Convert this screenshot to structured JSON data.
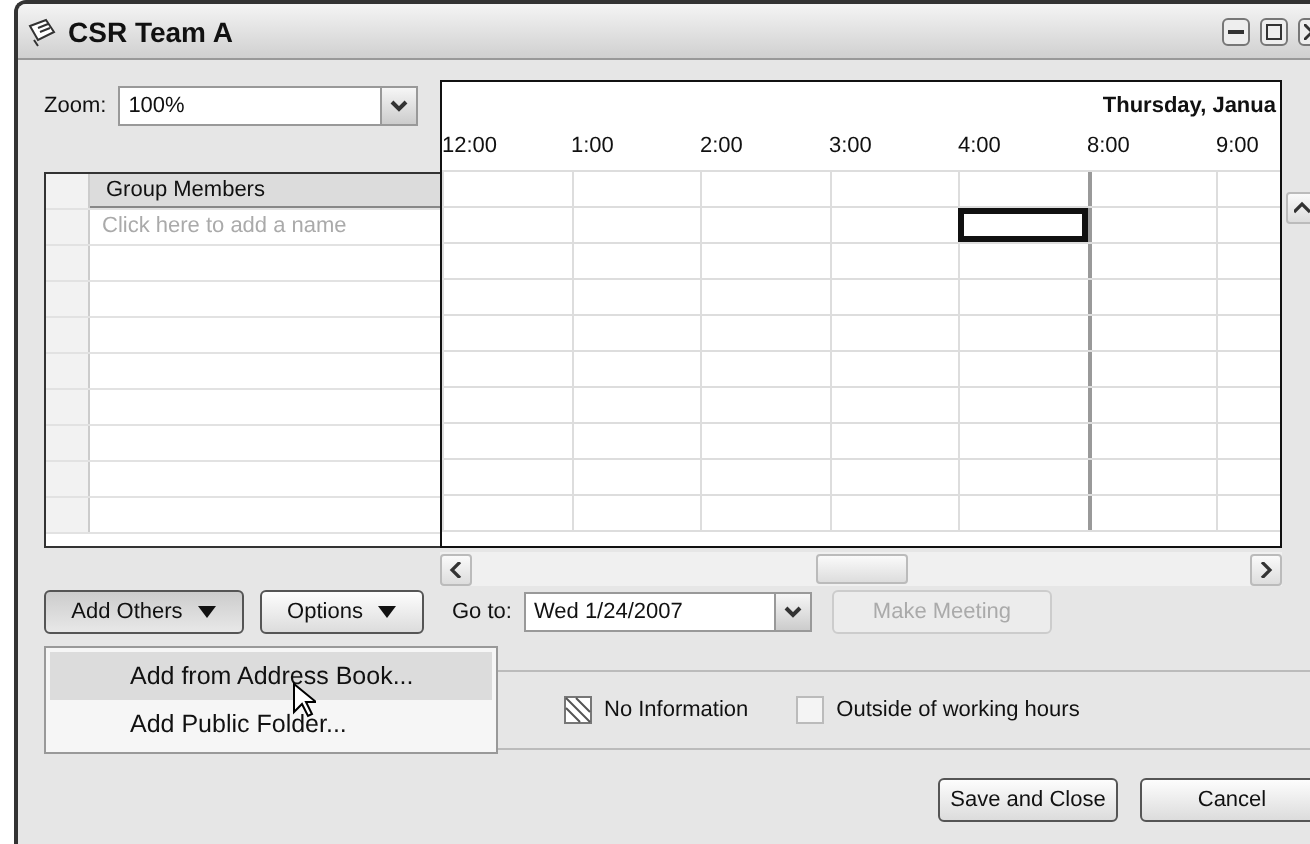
{
  "window": {
    "title": "CSR Team A"
  },
  "zoom": {
    "label": "Zoom:",
    "value": "100%"
  },
  "group_members": {
    "header": "Group Members",
    "placeholder": "Click here to add a name"
  },
  "schedule": {
    "date": "Thursday, Janua",
    "time_slots": [
      {
        "label": "12:00",
        "selected": false
      },
      {
        "label": "1:00",
        "selected": false
      },
      {
        "label": "2:00",
        "selected": false
      },
      {
        "label": "3:00",
        "selected": false
      },
      {
        "label": "4:00",
        "selected": true
      },
      {
        "label": "8:00",
        "selected": false
      },
      {
        "label": "9:00",
        "selected": false
      }
    ]
  },
  "toolbar": {
    "add_others": "Add Others",
    "options": "Options",
    "goto_label": "Go to:",
    "goto_date": "Wed 1/24/2007",
    "make_meeting": {
      "label": "Make Meeting",
      "disabled": true
    }
  },
  "menu": [
    {
      "label": "Add from Address Book...",
      "selected": true
    },
    {
      "label": "Add Public Folder...",
      "selected": false
    }
  ],
  "legend": [
    {
      "kind": "no_info",
      "label": "No Information"
    },
    {
      "kind": "outside",
      "label": "Outside of working hours"
    }
  ],
  "buttons": [
    "Save and Close",
    "Cancel"
  ]
}
